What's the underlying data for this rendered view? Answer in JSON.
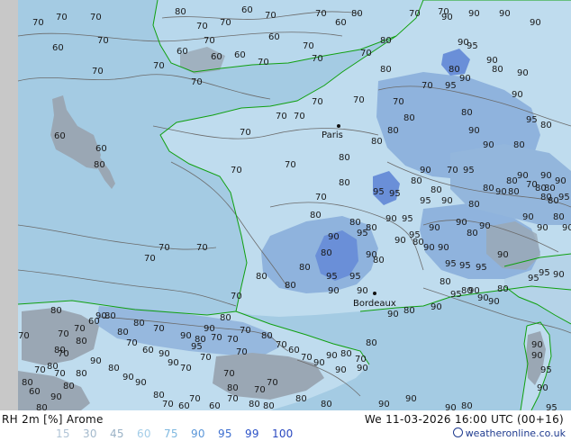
{
  "header": {
    "title": "RH 2m [%] Arome",
    "valid_time": "We 11-03-2026 16:00 UTC (00+16)",
    "credit": "weatheronline.co.uk"
  },
  "legend": {
    "items": [
      {
        "value": "15",
        "color": "#b0c4d6"
      },
      {
        "value": "30",
        "color": "#a3b9cc"
      },
      {
        "value": "45",
        "color": "#9ab2c6"
      },
      {
        "value": "60",
        "color": "#a3cde8"
      },
      {
        "value": "75",
        "color": "#7fb8e0"
      },
      {
        "value": "90",
        "color": "#5a96d9"
      },
      {
        "value": "95",
        "color": "#3d6fd0"
      },
      {
        "value": "99",
        "color": "#2c52c8"
      },
      {
        "value": "100",
        "color": "#2a48c0"
      }
    ]
  },
  "map": {
    "colors": {
      "sea": "#a4cbe3",
      "land_humid": "#bfdcee",
      "rh_90": "#8fb3dd",
      "rh_95": "#6a8fd8",
      "dry_land": "#9aa7b4",
      "left_margin": "#c8c8c8",
      "coastline": "#10a010",
      "isoline": "#6b6b6b"
    },
    "cities": [
      {
        "name": "Paris"
      },
      {
        "name": "Bordeaux"
      }
    ],
    "isoline_labels": [
      {
        "v": "70"
      },
      {
        "v": "70"
      },
      {
        "v": "70"
      },
      {
        "v": "70"
      },
      {
        "v": "60"
      },
      {
        "v": "70"
      },
      {
        "v": "70"
      },
      {
        "v": "80"
      },
      {
        "v": "70"
      },
      {
        "v": "70"
      },
      {
        "v": "60"
      },
      {
        "v": "70"
      },
      {
        "v": "60"
      },
      {
        "v": "70"
      },
      {
        "v": "60"
      },
      {
        "v": "70"
      },
      {
        "v": "70"
      },
      {
        "v": "60"
      },
      {
        "v": "70"
      },
      {
        "v": "60"
      },
      {
        "v": "60"
      },
      {
        "v": "70"
      },
      {
        "v": "70"
      },
      {
        "v": "70"
      },
      {
        "v": "70"
      },
      {
        "v": "80"
      },
      {
        "v": "70"
      },
      {
        "v": "80"
      },
      {
        "v": "80"
      },
      {
        "v": "70"
      },
      {
        "v": "70"
      },
      {
        "v": "90"
      },
      {
        "v": "90"
      },
      {
        "v": "90"
      },
      {
        "v": "90"
      },
      {
        "v": "90"
      },
      {
        "v": "95"
      },
      {
        "v": "80"
      },
      {
        "v": "90"
      },
      {
        "v": "90"
      },
      {
        "v": "95"
      },
      {
        "v": "60"
      },
      {
        "v": "60"
      },
      {
        "v": "80"
      },
      {
        "v": "70"
      },
      {
        "v": "70"
      },
      {
        "v": "70"
      },
      {
        "v": "70"
      },
      {
        "v": "70"
      },
      {
        "v": "80"
      },
      {
        "v": "70"
      },
      {
        "v": "80"
      },
      {
        "v": "80"
      },
      {
        "v": "70"
      },
      {
        "v": "80"
      },
      {
        "v": "80"
      },
      {
        "v": "90"
      },
      {
        "v": "90"
      },
      {
        "v": "95"
      },
      {
        "v": "80"
      },
      {
        "v": "90"
      },
      {
        "v": "90"
      },
      {
        "v": "80"
      },
      {
        "v": "70"
      },
      {
        "v": "95"
      },
      {
        "v": "90"
      },
      {
        "v": "80"
      },
      {
        "v": "80"
      },
      {
        "v": "95"
      },
      {
        "v": "95"
      },
      {
        "v": "95"
      },
      {
        "v": "90"
      },
      {
        "v": "80"
      },
      {
        "v": "90"
      },
      {
        "v": "80"
      },
      {
        "v": "80"
      },
      {
        "v": "90"
      },
      {
        "v": "80"
      },
      {
        "v": "90"
      },
      {
        "v": "90"
      },
      {
        "v": "80"
      },
      {
        "v": "80"
      },
      {
        "v": "70"
      },
      {
        "v": "80"
      },
      {
        "v": "95"
      },
      {
        "v": "90"
      },
      {
        "v": "90"
      },
      {
        "v": "95"
      },
      {
        "v": "95"
      },
      {
        "v": "90"
      },
      {
        "v": "90"
      },
      {
        "v": "80"
      },
      {
        "v": "90"
      },
      {
        "v": "80"
      },
      {
        "v": "90"
      },
      {
        "v": "90"
      },
      {
        "v": "95"
      },
      {
        "v": "95"
      },
      {
        "v": "95"
      },
      {
        "v": "90"
      },
      {
        "v": "80"
      },
      {
        "v": "80"
      },
      {
        "v": "90"
      },
      {
        "v": "70"
      },
      {
        "v": "70"
      },
      {
        "v": "70"
      },
      {
        "v": "70"
      },
      {
        "v": "80"
      },
      {
        "v": "80"
      },
      {
        "v": "80"
      },
      {
        "v": "80"
      },
      {
        "v": "80"
      },
      {
        "v": "80"
      },
      {
        "v": "90"
      },
      {
        "v": "95"
      },
      {
        "v": "95"
      },
      {
        "v": "90"
      },
      {
        "v": "90"
      },
      {
        "v": "80"
      },
      {
        "v": "90"
      },
      {
        "v": "80"
      },
      {
        "v": "80"
      },
      {
        "v": "90"
      },
      {
        "v": "80"
      },
      {
        "v": "90"
      },
      {
        "v": "70"
      },
      {
        "v": "80"
      },
      {
        "v": "80"
      },
      {
        "v": "90"
      },
      {
        "v": "95"
      },
      {
        "v": "95"
      },
      {
        "v": "90"
      },
      {
        "v": "95"
      },
      {
        "v": "80"
      },
      {
        "v": "90"
      },
      {
        "v": "90"
      },
      {
        "v": "95"
      },
      {
        "v": "90"
      },
      {
        "v": "80"
      },
      {
        "v": "90"
      },
      {
        "v": "80"
      },
      {
        "v": "90"
      },
      {
        "v": "80"
      },
      {
        "v": "70"
      },
      {
        "v": "80"
      },
      {
        "v": "70"
      },
      {
        "v": "80"
      },
      {
        "v": "70"
      },
      {
        "v": "80"
      },
      {
        "v": "70"
      },
      {
        "v": "60"
      },
      {
        "v": "70"
      },
      {
        "v": "70"
      },
      {
        "v": "70"
      },
      {
        "v": "80"
      },
      {
        "v": "70"
      },
      {
        "v": "70"
      },
      {
        "v": "80"
      },
      {
        "v": "80"
      },
      {
        "v": "90"
      },
      {
        "v": "90"
      },
      {
        "v": "90"
      },
      {
        "v": "90"
      },
      {
        "v": "90"
      },
      {
        "v": "80"
      },
      {
        "v": "90"
      },
      {
        "v": "90"
      },
      {
        "v": "95"
      },
      {
        "v": "90"
      },
      {
        "v": "95"
      },
      {
        "v": "90"
      },
      {
        "v": "80"
      },
      {
        "v": "70"
      },
      {
        "v": "70"
      },
      {
        "v": "70"
      },
      {
        "v": "80"
      },
      {
        "v": "70"
      },
      {
        "v": "60"
      },
      {
        "v": "70"
      },
      {
        "v": "90"
      },
      {
        "v": "90"
      },
      {
        "v": "80"
      },
      {
        "v": "70"
      },
      {
        "v": "80"
      },
      {
        "v": "80"
      },
      {
        "v": "80"
      },
      {
        "v": "70"
      },
      {
        "v": "60"
      },
      {
        "v": "70"
      },
      {
        "v": "60"
      },
      {
        "v": "70"
      },
      {
        "v": "80"
      },
      {
        "v": "90"
      },
      {
        "v": "90"
      },
      {
        "v": "80"
      },
      {
        "v": "90"
      },
      {
        "v": "80"
      },
      {
        "v": "80"
      },
      {
        "v": "90"
      },
      {
        "v": "80"
      },
      {
        "v": "80"
      },
      {
        "v": "70"
      },
      {
        "v": "70"
      },
      {
        "v": "70"
      },
      {
        "v": "60"
      },
      {
        "v": "80"
      },
      {
        "v": "80"
      },
      {
        "v": "70"
      },
      {
        "v": "60"
      },
      {
        "v": "90"
      },
      {
        "v": "90"
      },
      {
        "v": "95"
      },
      {
        "v": "90"
      },
      {
        "v": "80"
      },
      {
        "v": "70"
      }
    ]
  }
}
